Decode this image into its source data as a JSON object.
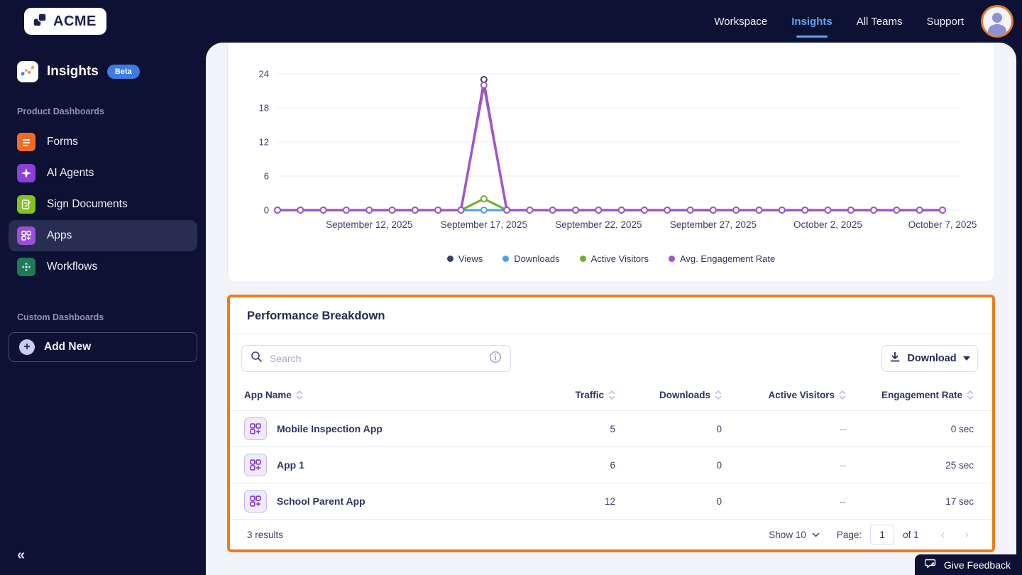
{
  "colors": {
    "topbar_bg": "#0d1133",
    "panel_bg": "#f3f4fb",
    "accent_orange": "#ee7c1b",
    "nav_active": "#5fa3e8",
    "views": "#3d4266",
    "downloads": "#4aa0f5",
    "active_visitors": "#6fae2f",
    "engagement": "#a155cb"
  },
  "topbar": {
    "logo_text": "ACME",
    "nav": [
      {
        "label": "Workspace",
        "active": false
      },
      {
        "label": "Insights",
        "active": true
      },
      {
        "label": "All Teams",
        "active": false
      },
      {
        "label": "Support",
        "active": false
      }
    ]
  },
  "sidebar": {
    "app_title": "Insights",
    "beta_badge": "Beta",
    "section1_label": "Product Dashboards",
    "items": [
      {
        "label": "Forms",
        "icon": "forms-icon",
        "color": "#f26b24",
        "active": false
      },
      {
        "label": "AI Agents",
        "icon": "ai-agents-icon",
        "color": "#8a3fd6",
        "active": false
      },
      {
        "label": "Sign Documents",
        "icon": "sign-documents-icon",
        "color": "#84c31c",
        "active": false
      },
      {
        "label": "Apps",
        "icon": "apps-icon",
        "color": "#9b4fd6",
        "active": true
      },
      {
        "label": "Workflows",
        "icon": "workflows-icon",
        "color": "#1e7a58",
        "active": false
      }
    ],
    "section2_label": "Custom Dashboards",
    "add_new_label": "Add New",
    "collapse_glyph": "«"
  },
  "chart_data": {
    "type": "line",
    "x": [
      "2025-09-08",
      "2025-09-09",
      "2025-09-10",
      "2025-09-11",
      "2025-09-12",
      "2025-09-13",
      "2025-09-14",
      "2025-09-15",
      "2025-09-16",
      "2025-09-17",
      "2025-09-18",
      "2025-09-19",
      "2025-09-20",
      "2025-09-21",
      "2025-09-22",
      "2025-09-23",
      "2025-09-24",
      "2025-09-25",
      "2025-09-26",
      "2025-09-27",
      "2025-09-28",
      "2025-09-29",
      "2025-09-30",
      "2025-10-01",
      "2025-10-02",
      "2025-10-03",
      "2025-10-04",
      "2025-10-05",
      "2025-10-06",
      "2025-10-07"
    ],
    "x_tick_indices": [
      4,
      9,
      14,
      19,
      24,
      29
    ],
    "x_tick_labels": [
      "September 12, 2025",
      "September 17, 2025",
      "September 22, 2025",
      "September 27, 2025",
      "October 2, 2025",
      "October 7, 2025"
    ],
    "yticks": [
      0,
      6,
      12,
      18,
      24
    ],
    "ylim": [
      0,
      24
    ],
    "grid": true,
    "legend_position": "bottom",
    "series": [
      {
        "name": "Views",
        "color": "#3d4266",
        "values": [
          0,
          0,
          0,
          0,
          0,
          0,
          0,
          0,
          0,
          23,
          0,
          0,
          0,
          0,
          0,
          0,
          0,
          0,
          0,
          0,
          0,
          0,
          0,
          0,
          0,
          0,
          0,
          0,
          0,
          0
        ]
      },
      {
        "name": "Downloads",
        "color": "#4aa0f5",
        "values": [
          0,
          0,
          0,
          0,
          0,
          0,
          0,
          0,
          0,
          0,
          0,
          0,
          0,
          0,
          0,
          0,
          0,
          0,
          0,
          0,
          0,
          0,
          0,
          0,
          0,
          0,
          0,
          0,
          0,
          0
        ]
      },
      {
        "name": "Active Visitors",
        "color": "#6fae2f",
        "values": [
          0,
          0,
          0,
          0,
          0,
          0,
          0,
          0,
          0,
          2,
          0,
          0,
          0,
          0,
          0,
          0,
          0,
          0,
          0,
          0,
          0,
          0,
          0,
          0,
          0,
          0,
          0,
          0,
          0,
          0
        ]
      },
      {
        "name": "Avg. Engagement Rate",
        "color": "#a155cb",
        "values": [
          0,
          0,
          0,
          0,
          0,
          0,
          0,
          0,
          0,
          22,
          0,
          0,
          0,
          0,
          0,
          0,
          0,
          0,
          0,
          0,
          0,
          0,
          0,
          0,
          0,
          0,
          0,
          0,
          0,
          0
        ]
      }
    ]
  },
  "performance": {
    "title": "Performance Breakdown",
    "search_placeholder": "Search",
    "download_label": "Download",
    "columns": [
      "App Name",
      "Traffic",
      "Downloads",
      "Active Visitors",
      "Engagement Rate"
    ],
    "rows": [
      {
        "name": "Mobile Inspection App",
        "traffic": "5",
        "downloads": "0",
        "active_visitors": "--",
        "engagement_rate": "0 sec"
      },
      {
        "name": "App 1",
        "traffic": "6",
        "downloads": "0",
        "active_visitors": "--",
        "engagement_rate": "25 sec"
      },
      {
        "name": "School Parent App",
        "traffic": "12",
        "downloads": "0",
        "active_visitors": "--",
        "engagement_rate": "17 sec"
      }
    ],
    "footer": {
      "results": "3 results",
      "show_label": "Show 10",
      "page_label": "Page:",
      "page_value": "1",
      "of_label": "of 1",
      "prev_glyph": "‹",
      "next_glyph": "›"
    }
  },
  "feedback_button": {
    "label": "Give Feedback"
  }
}
